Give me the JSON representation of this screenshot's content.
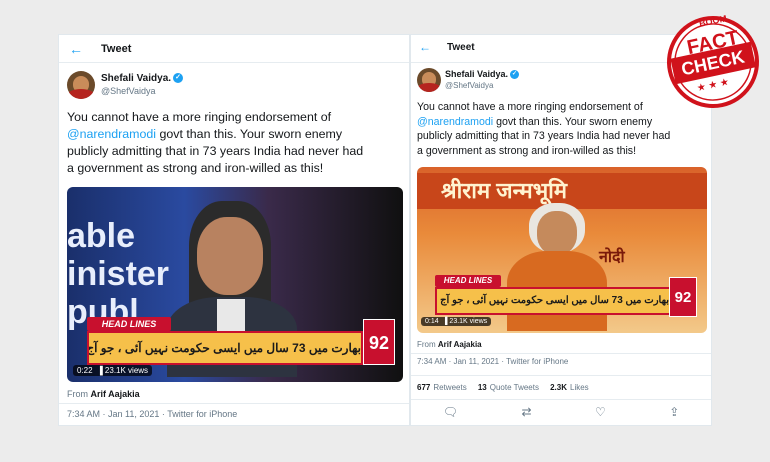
{
  "left": {
    "header": {
      "title": "Tweet"
    },
    "user": {
      "name": "Shefali Vaidya.",
      "handle": "@ShefVaidya"
    },
    "text": {
      "line1": "You cannot have a more ringing endorsement of",
      "mention": "@narendramodi",
      "line2_rest": " govt than this. Your sworn enemy",
      "line3": "publicly admitting that in 73 years India had never had",
      "line4": "a government as strong and iron-willed as this!"
    },
    "video": {
      "headlines": "HEAD LINES",
      "ticker": "بھارت میں 73 سال میں ایسی حکومت نہیں آئی ، جو آج ہے ، وزیر اعظم",
      "logo": "92",
      "time": "0:22",
      "views": "23.1K views",
      "bg_text_1": "able",
      "bg_text_2": "inister",
      "bg_text_3": "publ"
    },
    "from_label": "From ",
    "from_name": "Arif Aajakia",
    "meta": "7:34 AM · Jan 11, 2021 · Twitter for iPhone"
  },
  "right": {
    "header": {
      "title": "Tweet"
    },
    "user": {
      "name": "Shefali Vaidya.",
      "handle": "@ShefVaidya"
    },
    "text": {
      "line1": "You cannot have a more ringing endorsement of",
      "mention": "@narendramodi",
      "line2_rest": " govt than this. Your sworn enemy",
      "line3": "publicly admitting that in 73 years India had never had",
      "line4": "a government as strong and iron-willed as this!"
    },
    "video": {
      "headlines": "HEAD LINES",
      "ticker": "بھارت میں 73 سال میں ایسی حکومت نہیں آئی ، جو آج ہے ، وزیر اعظم",
      "logo": "92",
      "time": "0:14",
      "views": "23.1K views",
      "banner": "श्रीराम जन्मभूमि",
      "banner2": "नोदी"
    },
    "from_label": "From ",
    "from_name": "Arif Aajakia",
    "meta": "7:34 AM · Jan 11, 2021 · Twitter for iPhone",
    "stats": {
      "retweets": "677",
      "retweets_label": "Retweets",
      "quotes": "13",
      "quotes_label": "Quote Tweets",
      "likes": "2.3K",
      "likes_label": "Likes"
    }
  },
  "factcheck": {
    "top": "BOOM",
    "line1": "FACT",
    "line2": "CHECK",
    "stars": "★ ★ ★"
  },
  "colors": {
    "twitter_blue": "#1da1f2",
    "stamp_red": "#d0121b",
    "ticker_yellow": "#f6c04a"
  },
  "icons": [
    "back-arrow-icon",
    "verified-icon",
    "more-icon",
    "reply-icon",
    "retweet-icon",
    "like-icon",
    "share-icon"
  ]
}
